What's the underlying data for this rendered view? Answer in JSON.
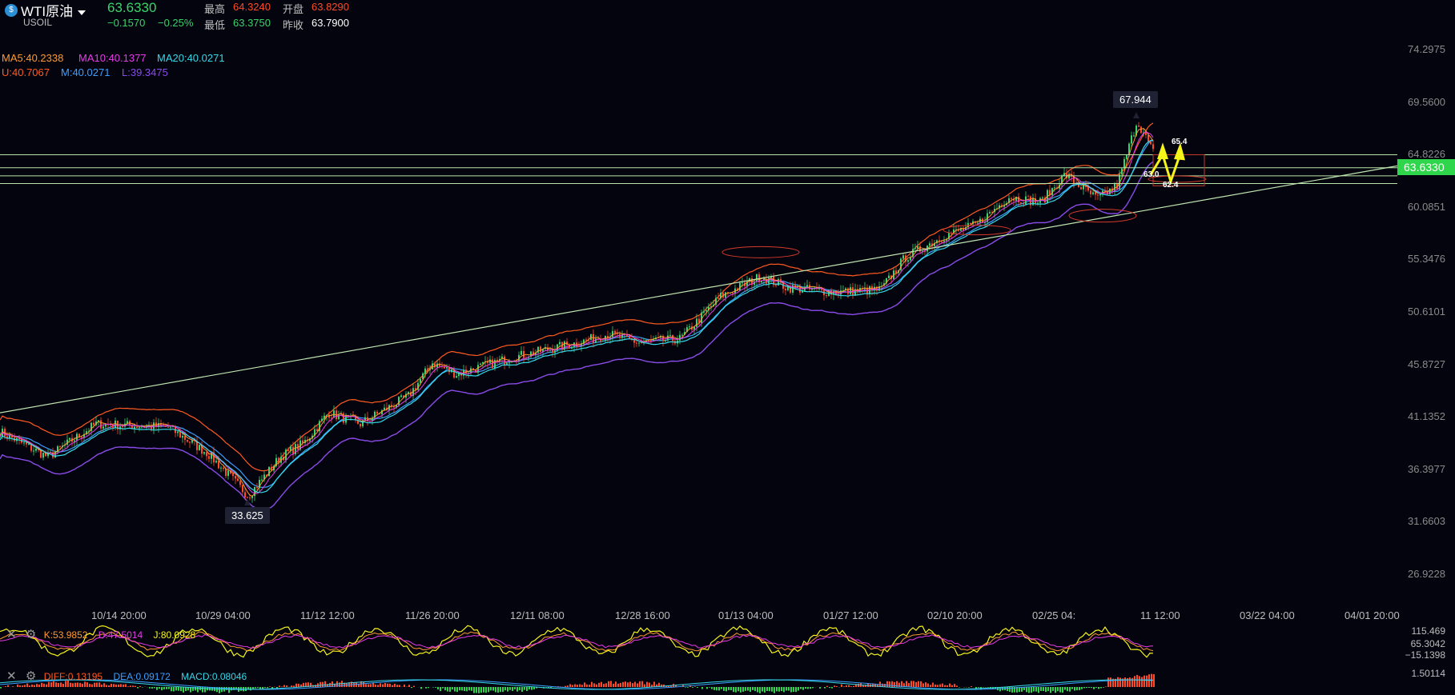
{
  "header": {
    "symbol_name": "WTI原油",
    "symbol_code": "USOIL",
    "price": "63.6330",
    "change": "−0.1570",
    "change_pct": "−0.25%",
    "high_label": "最高",
    "high_value": "64.3240",
    "open_label": "开盘",
    "open_value": "63.8290",
    "low_label": "最低",
    "low_value": "63.3750",
    "prev_label": "昨收",
    "prev_value": "63.7900"
  },
  "indicators": {
    "ma5": "MA5:40.2338",
    "ma10": "MA10:40.1377",
    "ma20": "MA20:40.0271",
    "upper": "U:40.7067",
    "mid": "M:40.0271",
    "lower": "L:39.3475"
  },
  "colors": {
    "up": "#3ad46a",
    "down": "#ff4a2a",
    "ma5": "#ff9a2e",
    "ma10": "#e83be8",
    "ma20": "#35d8e8",
    "boll_u": "#ff5a1f",
    "boll_m": "#3aa0ff",
    "boll_l": "#8a4be8",
    "grid_line": "#b8e6a8",
    "arrow": "#f5f51a"
  },
  "y_axis": [
    "74.2975",
    "69.5600",
    "64.8226",
    "60.0851",
    "55.3476",
    "50.6101",
    "45.8727",
    "41.1352",
    "36.3977",
    "31.6603",
    "26.9228"
  ],
  "x_axis": [
    "10/14 20:00",
    "10/29 04:00",
    "11/12 12:00",
    "11/26 20:00",
    "12/11 08:00",
    "12/28 16:00",
    "01/13 04:00",
    "01/27 12:00",
    "02/10 20:00",
    "02/25 04:",
    "11 12:00",
    "03/22 04:00",
    "04/01 20:00"
  ],
  "current_price_tag": "63.6330",
  "annotations": {
    "high_marker": "67.944",
    "low_marker": "33.625",
    "arrow_top": "65.4",
    "arrow_mid": "63.0",
    "arrow_bottom": "62.4"
  },
  "kdj": {
    "k": "K:53.9852",
    "d": "D:47.5014",
    "j": "J:80.0928",
    "axis": [
      "115.469",
      "65.3042",
      "−15.1398"
    ]
  },
  "macd": {
    "diff": "DIFF:0.13195",
    "dea": "DEA:0.09172",
    "macd": "MACD:0.08046",
    "axis": [
      "1.50114"
    ]
  },
  "chart_data": {
    "type": "candlestick",
    "title": "WTI原油",
    "x": [
      "10/14 20:00",
      "10/29 04:00",
      "11/12 12:00",
      "11/26 20:00",
      "12/11 08:00",
      "12/28 16:00",
      "01/13 04:00",
      "01/27 12:00",
      "02/10 20:00",
      "02/25 04:00",
      "03/11 12:00"
    ],
    "ylim": [
      26.9228,
      74.2975
    ],
    "series": [
      {
        "name": "price",
        "values": [
          39.8,
          34.2,
          39.0,
          45.5,
          47.2,
          48.5,
          53.8,
          52.6,
          57.8,
          62.5,
          63.63
        ]
      }
    ],
    "horizontal_levels": [
      64.8,
      63.63,
      62.9,
      62.2
    ],
    "trendline": {
      "from": [
        0,
        41.5
      ],
      "to": [
        1,
        63.8
      ]
    },
    "markers": {
      "high": 67.944,
      "low": 33.625
    }
  }
}
